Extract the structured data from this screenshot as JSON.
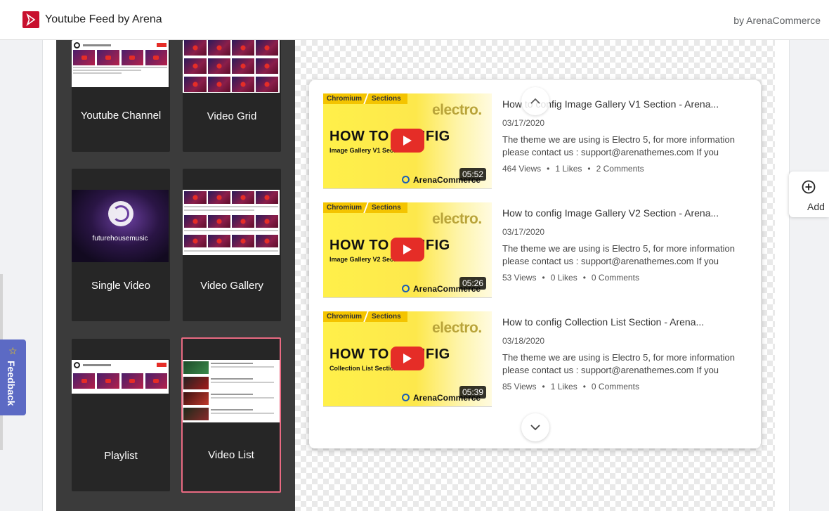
{
  "header": {
    "app_title": "Youtube Feed by Arena",
    "byline": "by ArenaCommerce",
    "brand_color": "#c8102e"
  },
  "layouts": [
    {
      "label": "Youtube Channel"
    },
    {
      "label": "Video Grid"
    },
    {
      "label": "Single Video",
      "thumb_text": "futurehousemusic"
    },
    {
      "label": "Video Gallery"
    },
    {
      "label": "Playlist"
    },
    {
      "label": "Video List",
      "selected": true
    }
  ],
  "selected_color": "#e96a82",
  "videos": [
    {
      "title": "How to config Image Gallery V1 Section - Arena...",
      "date": "03/17/2020",
      "description": "The theme we are using is Electro 5, for more information please contact us : support@arenathemes.com If you like...",
      "views": "464 Views",
      "likes": "1 Likes",
      "comments": "2 Comments",
      "duration": "05:52",
      "thumb_sub": "Image Gallery V1 Sections"
    },
    {
      "title": "How to config Image Gallery V2 Section - Arena...",
      "date": "03/17/2020",
      "description": "The theme we are using is Electro 5, for more information please contact us : support@arenathemes.com If you like...",
      "views": "53 Views",
      "likes": "0 Likes",
      "comments": "0 Comments",
      "duration": "05:26",
      "thumb_sub": "Image Gallery V2 Sections"
    },
    {
      "title": "How to config Collection List Section - Arena...",
      "date": "03/18/2020",
      "description": "The theme we are using is Electro 5, for more information please contact us : support@arenathemes.com If you like...",
      "views": "85 Views",
      "likes": "1 Likes",
      "comments": "0 Comments",
      "duration": "05:39",
      "thumb_sub": "Collection List Sections"
    }
  ],
  "thumb": {
    "tag1": "Chromium",
    "tag2": "Sections",
    "brand": "electro.",
    "headline": "HOW TO CONFIG",
    "footer": "ArenaCommerce"
  },
  "stat_separator": "•",
  "add_button": {
    "label": "Add",
    "icon": "plus-circle-icon"
  },
  "feedback": {
    "label": "Feedback",
    "star": "☆",
    "color": "#5c6ac4"
  }
}
